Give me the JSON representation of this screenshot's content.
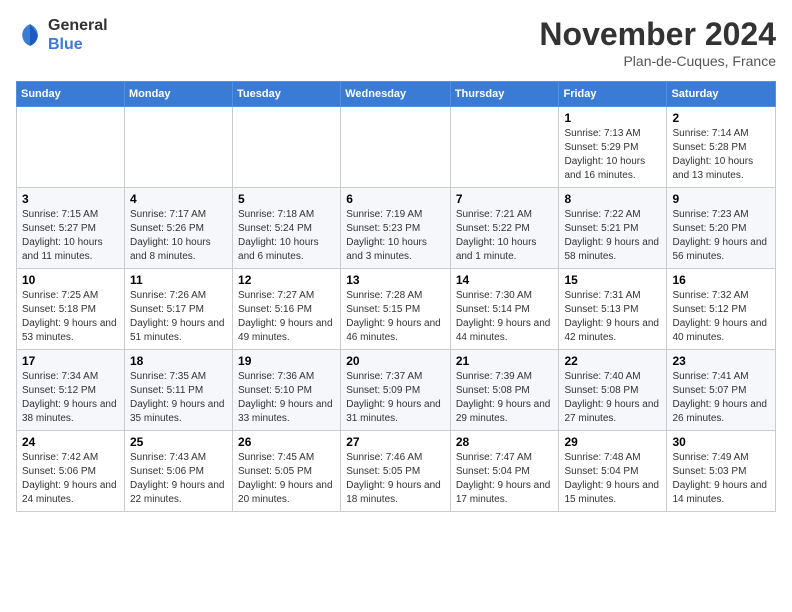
{
  "logo": {
    "general": "General",
    "blue": "Blue"
  },
  "title": "November 2024",
  "location": "Plan-de-Cuques, France",
  "weekdays": [
    "Sunday",
    "Monday",
    "Tuesday",
    "Wednesday",
    "Thursday",
    "Friday",
    "Saturday"
  ],
  "weeks": [
    [
      {
        "day": "",
        "info": ""
      },
      {
        "day": "",
        "info": ""
      },
      {
        "day": "",
        "info": ""
      },
      {
        "day": "",
        "info": ""
      },
      {
        "day": "",
        "info": ""
      },
      {
        "day": "1",
        "info": "Sunrise: 7:13 AM\nSunset: 5:29 PM\nDaylight: 10 hours and 16 minutes."
      },
      {
        "day": "2",
        "info": "Sunrise: 7:14 AM\nSunset: 5:28 PM\nDaylight: 10 hours and 13 minutes."
      }
    ],
    [
      {
        "day": "3",
        "info": "Sunrise: 7:15 AM\nSunset: 5:27 PM\nDaylight: 10 hours and 11 minutes."
      },
      {
        "day": "4",
        "info": "Sunrise: 7:17 AM\nSunset: 5:26 PM\nDaylight: 10 hours and 8 minutes."
      },
      {
        "day": "5",
        "info": "Sunrise: 7:18 AM\nSunset: 5:24 PM\nDaylight: 10 hours and 6 minutes."
      },
      {
        "day": "6",
        "info": "Sunrise: 7:19 AM\nSunset: 5:23 PM\nDaylight: 10 hours and 3 minutes."
      },
      {
        "day": "7",
        "info": "Sunrise: 7:21 AM\nSunset: 5:22 PM\nDaylight: 10 hours and 1 minute."
      },
      {
        "day": "8",
        "info": "Sunrise: 7:22 AM\nSunset: 5:21 PM\nDaylight: 9 hours and 58 minutes."
      },
      {
        "day": "9",
        "info": "Sunrise: 7:23 AM\nSunset: 5:20 PM\nDaylight: 9 hours and 56 minutes."
      }
    ],
    [
      {
        "day": "10",
        "info": "Sunrise: 7:25 AM\nSunset: 5:18 PM\nDaylight: 9 hours and 53 minutes."
      },
      {
        "day": "11",
        "info": "Sunrise: 7:26 AM\nSunset: 5:17 PM\nDaylight: 9 hours and 51 minutes."
      },
      {
        "day": "12",
        "info": "Sunrise: 7:27 AM\nSunset: 5:16 PM\nDaylight: 9 hours and 49 minutes."
      },
      {
        "day": "13",
        "info": "Sunrise: 7:28 AM\nSunset: 5:15 PM\nDaylight: 9 hours and 46 minutes."
      },
      {
        "day": "14",
        "info": "Sunrise: 7:30 AM\nSunset: 5:14 PM\nDaylight: 9 hours and 44 minutes."
      },
      {
        "day": "15",
        "info": "Sunrise: 7:31 AM\nSunset: 5:13 PM\nDaylight: 9 hours and 42 minutes."
      },
      {
        "day": "16",
        "info": "Sunrise: 7:32 AM\nSunset: 5:12 PM\nDaylight: 9 hours and 40 minutes."
      }
    ],
    [
      {
        "day": "17",
        "info": "Sunrise: 7:34 AM\nSunset: 5:12 PM\nDaylight: 9 hours and 38 minutes."
      },
      {
        "day": "18",
        "info": "Sunrise: 7:35 AM\nSunset: 5:11 PM\nDaylight: 9 hours and 35 minutes."
      },
      {
        "day": "19",
        "info": "Sunrise: 7:36 AM\nSunset: 5:10 PM\nDaylight: 9 hours and 33 minutes."
      },
      {
        "day": "20",
        "info": "Sunrise: 7:37 AM\nSunset: 5:09 PM\nDaylight: 9 hours and 31 minutes."
      },
      {
        "day": "21",
        "info": "Sunrise: 7:39 AM\nSunset: 5:08 PM\nDaylight: 9 hours and 29 minutes."
      },
      {
        "day": "22",
        "info": "Sunrise: 7:40 AM\nSunset: 5:08 PM\nDaylight: 9 hours and 27 minutes."
      },
      {
        "day": "23",
        "info": "Sunrise: 7:41 AM\nSunset: 5:07 PM\nDaylight: 9 hours and 26 minutes."
      }
    ],
    [
      {
        "day": "24",
        "info": "Sunrise: 7:42 AM\nSunset: 5:06 PM\nDaylight: 9 hours and 24 minutes."
      },
      {
        "day": "25",
        "info": "Sunrise: 7:43 AM\nSunset: 5:06 PM\nDaylight: 9 hours and 22 minutes."
      },
      {
        "day": "26",
        "info": "Sunrise: 7:45 AM\nSunset: 5:05 PM\nDaylight: 9 hours and 20 minutes."
      },
      {
        "day": "27",
        "info": "Sunrise: 7:46 AM\nSunset: 5:05 PM\nDaylight: 9 hours and 18 minutes."
      },
      {
        "day": "28",
        "info": "Sunrise: 7:47 AM\nSunset: 5:04 PM\nDaylight: 9 hours and 17 minutes."
      },
      {
        "day": "29",
        "info": "Sunrise: 7:48 AM\nSunset: 5:04 PM\nDaylight: 9 hours and 15 minutes."
      },
      {
        "day": "30",
        "info": "Sunrise: 7:49 AM\nSunset: 5:03 PM\nDaylight: 9 hours and 14 minutes."
      }
    ]
  ]
}
